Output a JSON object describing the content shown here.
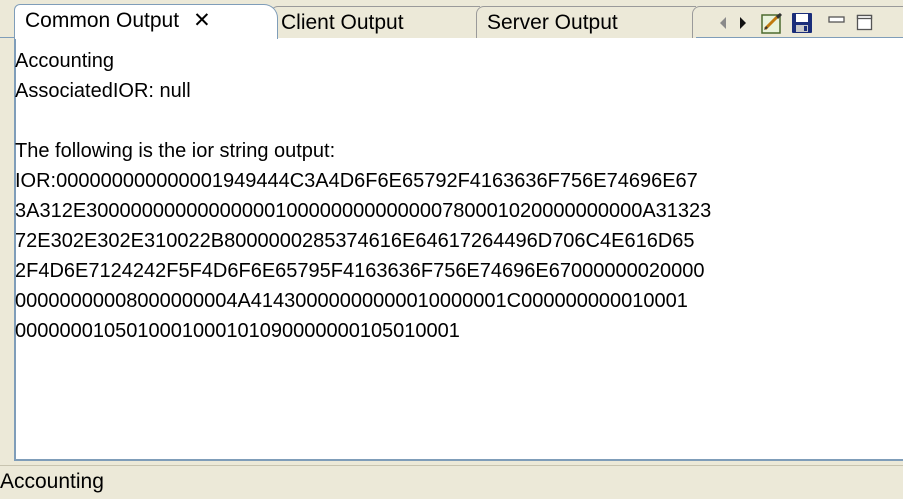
{
  "tabs": [
    {
      "label": "Common Output",
      "close": "✕",
      "active": true
    },
    {
      "label": "Client Output",
      "active": false
    },
    {
      "label": "Server Output",
      "active": false
    }
  ],
  "view_controls": [
    "scroll-left-icon",
    "scroll-right-icon",
    "edit-icon",
    "save-icon",
    "minimize-icon",
    "maximize-icon"
  ],
  "output": {
    "line1": "Accounting",
    "line2": "AssociatedIOR: null",
    "line3": "",
    "line4": "The following is the ior string output:",
    "ior_lines": [
      "IOR:000000000000001949444C3A4D6F6E65792F4163636F756E74696E67",
      "3A312E30000000000000000100000000000000780001020000000000A31323",
      "72E302E302E310022B800000028537461 6E64617264496D706C4E616D65",
      "2F4D6E7124242F5F4D6F6E65795F4163636F756E74696E67000000020000",
      "00000000008000000004A41430000000000010000001C000000000010001",
      "0000000105010001000101090000000105010001"
    ]
  },
  "status": {
    "text": "Accounting"
  },
  "colors": {
    "background": "#ece9d8",
    "border": "#7f9db9",
    "content": "#ffffff"
  }
}
